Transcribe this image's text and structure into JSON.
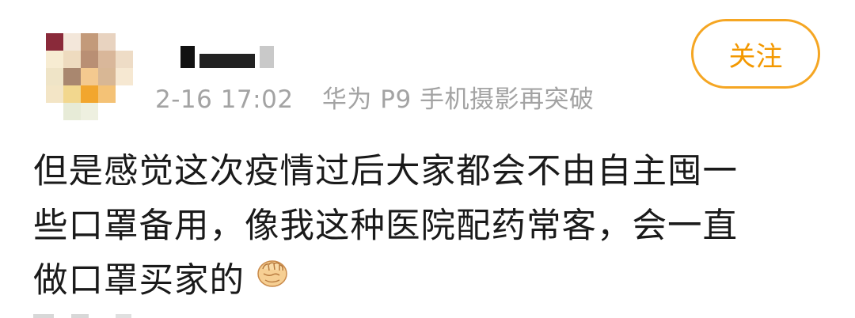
{
  "post": {
    "time": "2-16 17:02",
    "source": "华为 P9 手机摄影再突破",
    "follow_label": "关注",
    "body_lines": [
      "但是感觉这次疫情过后大家都会不由自主囤一",
      "些口罩备用，像我这种医院配药常客，会一直",
      "做口罩买家的"
    ],
    "emoji_icon": "fist-emoji"
  },
  "colors": {
    "accent": "#f39800",
    "meta_gray": "#a3a3a3",
    "text": "#1a1a1a"
  }
}
